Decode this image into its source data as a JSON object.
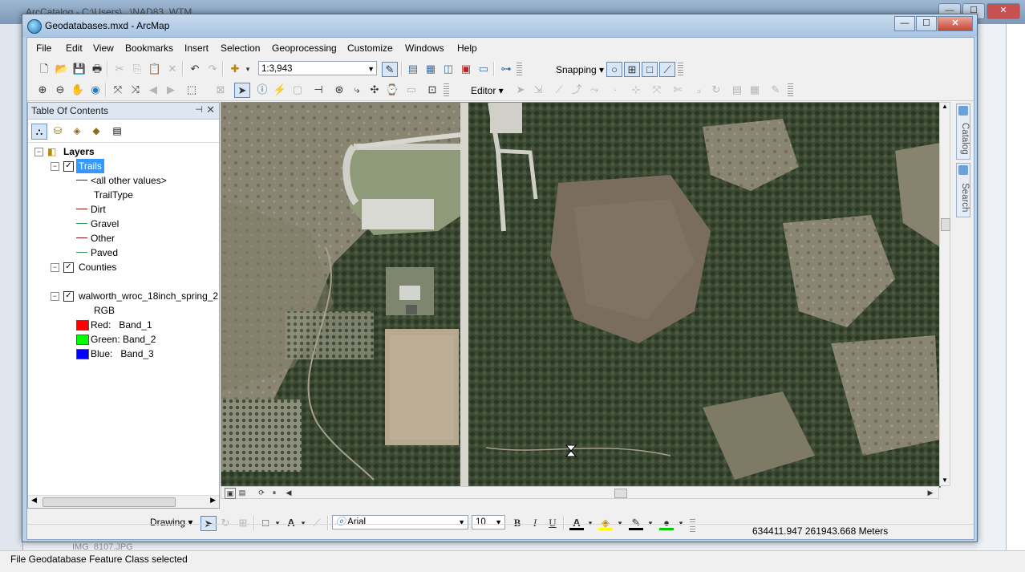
{
  "background": {
    "app_title": "ArcCatalog - C:\\Users\\...\\NAD83_WTM",
    "status_text": "File Geodatabase Feature Class selected",
    "tree_hint": "IMG_8107.JPG"
  },
  "window": {
    "title": "Geodatabases.mxd - ArcMap",
    "minimize": "—",
    "maximize": "☐",
    "close": "✕"
  },
  "menu": [
    "File",
    "Edit",
    "View",
    "Bookmarks",
    "Insert",
    "Selection",
    "Geoprocessing",
    "Customize",
    "Windows",
    "Help"
  ],
  "standard_toolbar": {
    "scale": "1:3,943",
    "snapping_label": "Snapping ▾",
    "editor_label": "Editor ▾"
  },
  "toc": {
    "title": "Table Of Contents",
    "pin": "⊣",
    "close": "✕",
    "root": "Layers",
    "layers": [
      {
        "name": "Trails",
        "checked": true,
        "selected": true,
        "legend": [
          {
            "label": "<all other values>",
            "kind": "line",
            "color": "#333333"
          },
          {
            "label": "TrailType",
            "kind": "heading",
            "color": ""
          },
          {
            "label": "Dirt",
            "kind": "line",
            "color": "#8b1a1a"
          },
          {
            "label": "Gravel",
            "kind": "line",
            "color": "#2e8b57"
          },
          {
            "label": "Other",
            "kind": "line",
            "color": "#8b1a1a"
          },
          {
            "label": "Paved",
            "kind": "line",
            "color": "#2e8b57"
          }
        ]
      },
      {
        "name": "Counties",
        "checked": true,
        "selected": false,
        "legend": []
      },
      {
        "name": "walworth_wroc_18inch_spring_2",
        "checked": true,
        "selected": false,
        "legend": [
          {
            "label": "RGB",
            "kind": "heading",
            "color": ""
          },
          {
            "label": "Red:   Band_1",
            "kind": "box",
            "color": "#ff0000"
          },
          {
            "label": "Green: Band_2",
            "kind": "box",
            "color": "#00ff00"
          },
          {
            "label": "Blue:   Band_3",
            "kind": "box",
            "color": "#0000ff"
          }
        ]
      }
    ]
  },
  "dock_tabs": [
    "Catalog",
    "Search"
  ],
  "drawing_toolbar": {
    "drawing_label": "Drawing ▾",
    "font": "Arial",
    "size": "10",
    "bold": "B",
    "italic": "I",
    "underline": "U"
  },
  "status": {
    "coordinates": "634411.947  261943.668 Meters"
  }
}
